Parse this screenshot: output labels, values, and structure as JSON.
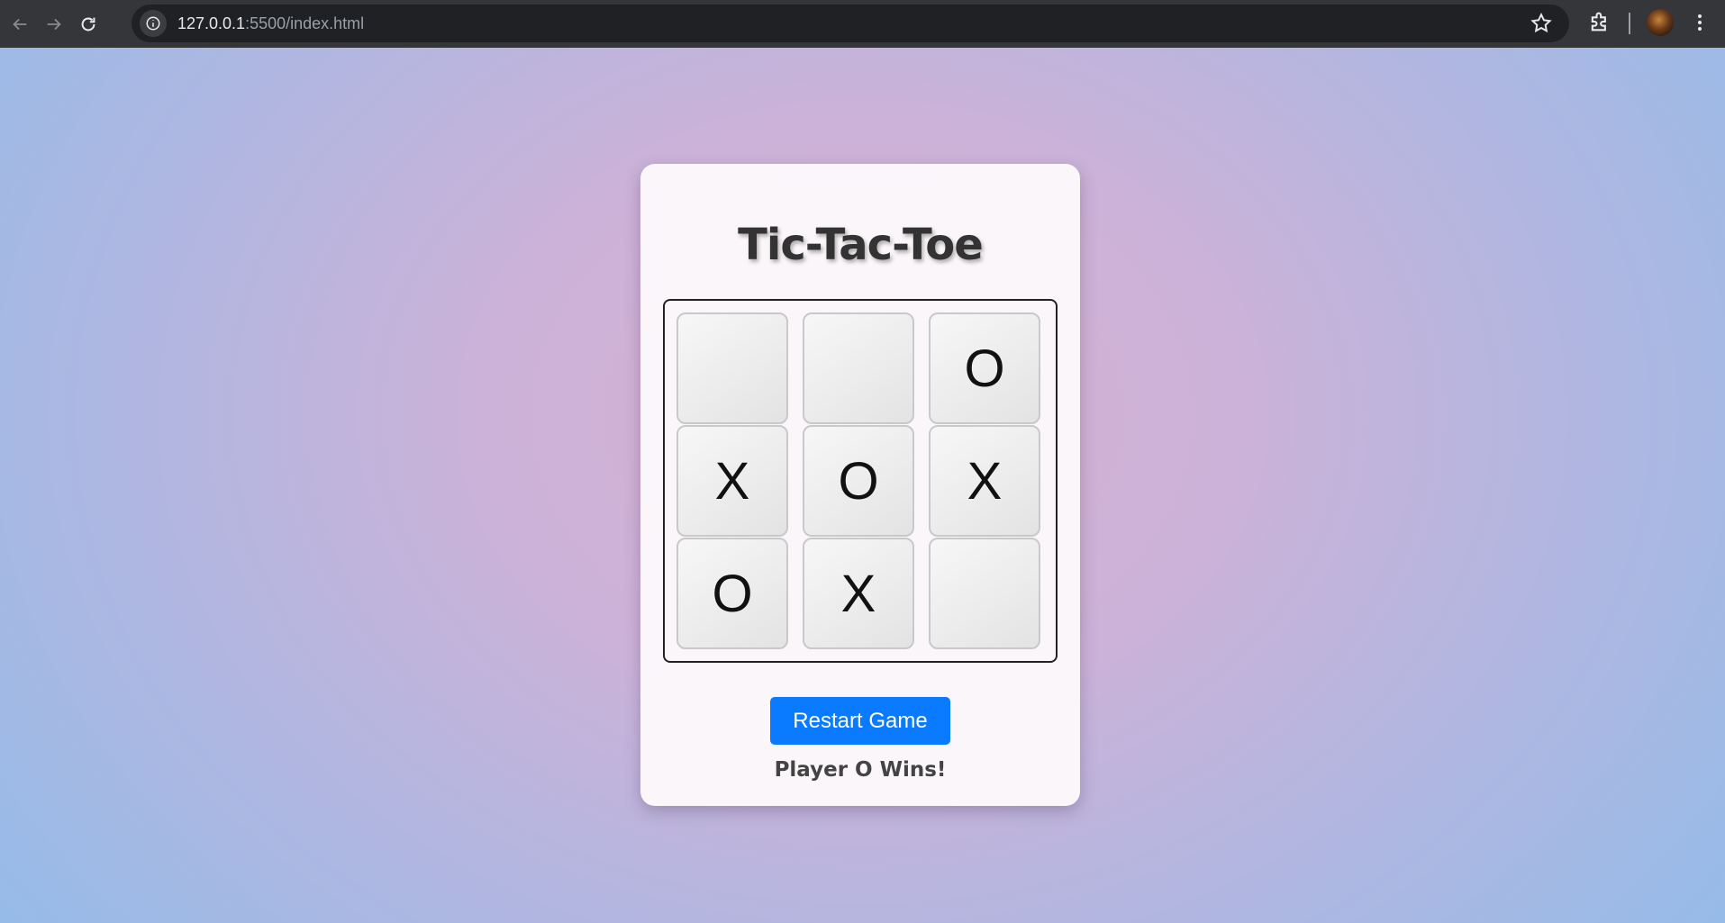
{
  "browser": {
    "url_host": "127.0.0.1",
    "url_path": ":5500/index.html"
  },
  "game": {
    "title": "Tic-Tac-Toe",
    "board": [
      "",
      "",
      "O",
      "X",
      "O",
      "X",
      "O",
      "X",
      ""
    ],
    "restart_label": "Restart Game",
    "status": "Player O Wins!"
  },
  "colors": {
    "button": "#0a7bff",
    "card": "#faf6f9"
  }
}
